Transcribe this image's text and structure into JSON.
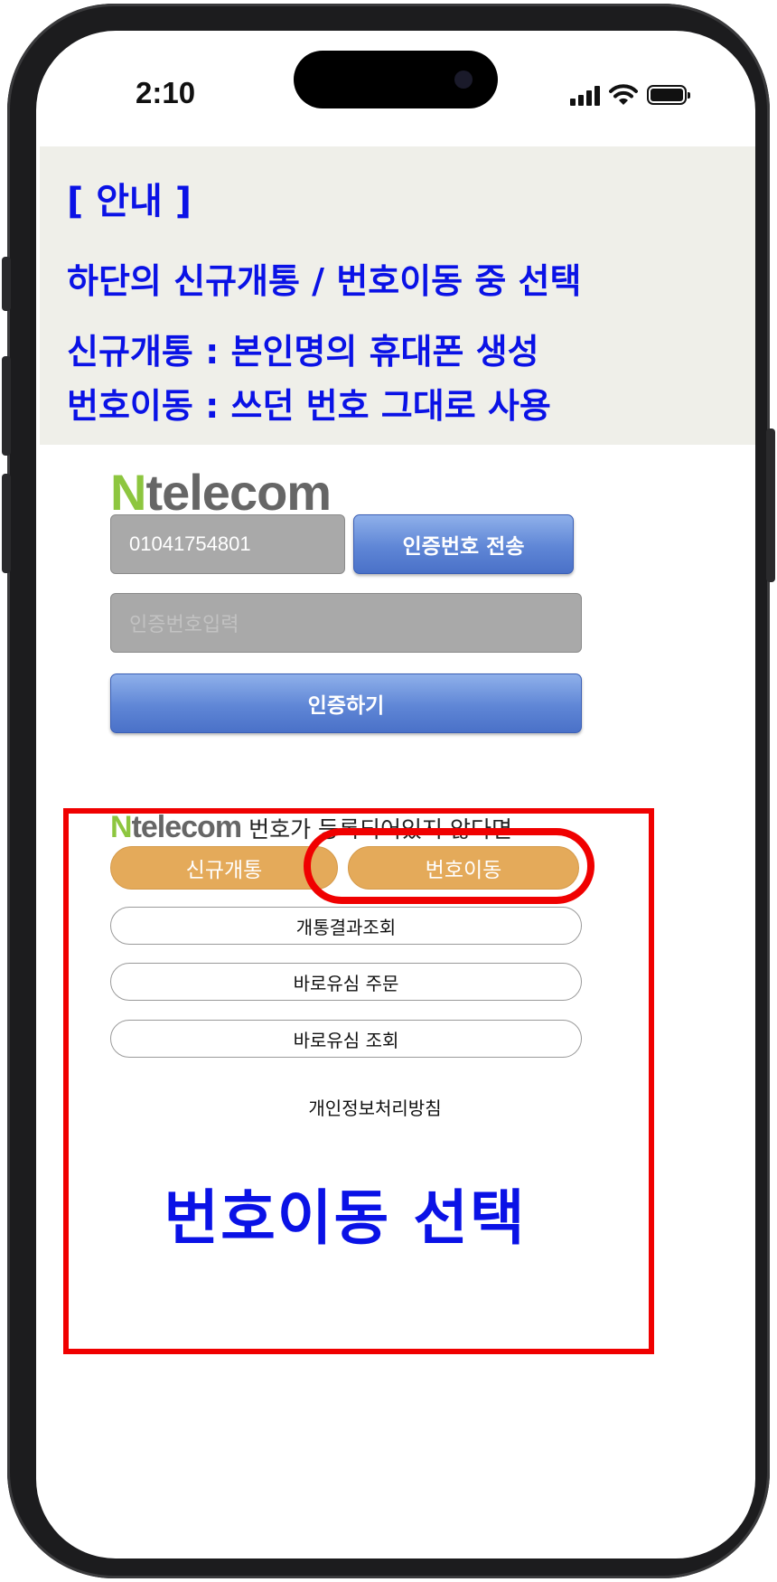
{
  "status_bar": {
    "time": "2:10",
    "icons": [
      "cellular-signal-icon",
      "wifi-icon",
      "battery-icon"
    ]
  },
  "notice": {
    "heading": "[ 안내 ]",
    "line1": "하단의 신규개통 / 번호이동 중 선택",
    "line2": "신규개통 : 본인명의 휴대폰 생성",
    "line3": "번호이동 : 쓰던 번호 그대로 사용"
  },
  "brand": {
    "letter": "N",
    "name": "telecom",
    "colors": {
      "n": "#8dc63f",
      "name": "#666666"
    }
  },
  "form": {
    "phone_value": "01041754801",
    "send_code_label": "인증번호 전송",
    "code_placeholder": "인증번호입력",
    "verify_label": "인증하기"
  },
  "register": {
    "prompt": "번호가 등록되어있지 않다면",
    "new_label": "신규개통",
    "port_label": "번호이동",
    "result_label": "개통결과조회",
    "usim_order_label": "바로유심 주문",
    "usim_check_label": "바로유심 조회",
    "privacy_label": "개인정보처리방침"
  },
  "annotation": {
    "caption": "번호이동 선택",
    "colors": {
      "frame": "#f00000",
      "text": "#0a12e6"
    }
  },
  "colors": {
    "notice_bg": "#efefe9",
    "orange_button": "#e4aa5a",
    "blue_button": "#5f86d6",
    "input_bg": "#a9a9a9"
  }
}
